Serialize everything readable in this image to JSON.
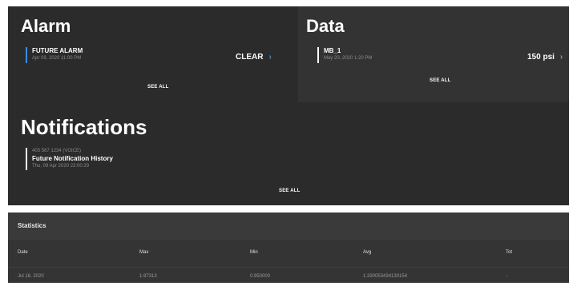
{
  "alarm": {
    "title": "Alarm",
    "item": {
      "name": "FUTURE ALARM",
      "timestamp": "Apr 09, 2020 11:00 PM"
    },
    "action_label": "CLEAR",
    "see_all": "SEE ALL"
  },
  "data_card": {
    "title": "Data",
    "item": {
      "name": "MB_1",
      "timestamp": "May 20, 2020 1:20 PM"
    },
    "value": "150 psi",
    "see_all": "SEE ALL"
  },
  "notifications": {
    "title": "Notifications",
    "item": {
      "caller": "403 567 1234 (VOICE)",
      "name": "Future Notification History",
      "timestamp": "Thu, 09 Apr 2020 23:00:29"
    },
    "see_all": "SEE ALL"
  },
  "statistics": {
    "title": "Statistics",
    "columns": [
      "Date",
      "Max",
      "Min",
      "Avg",
      "Tot"
    ],
    "rows": [
      [
        "Jul 16, 2020",
        "1.97313",
        "0.950000",
        "1.330053434130154",
        "-"
      ]
    ]
  },
  "colors": {
    "panel": "#2f2f2f",
    "accent_blue": "#3a8fe0",
    "muted_text": "#8a8a8a"
  },
  "icons": [
    "chevron-right-icon"
  ]
}
